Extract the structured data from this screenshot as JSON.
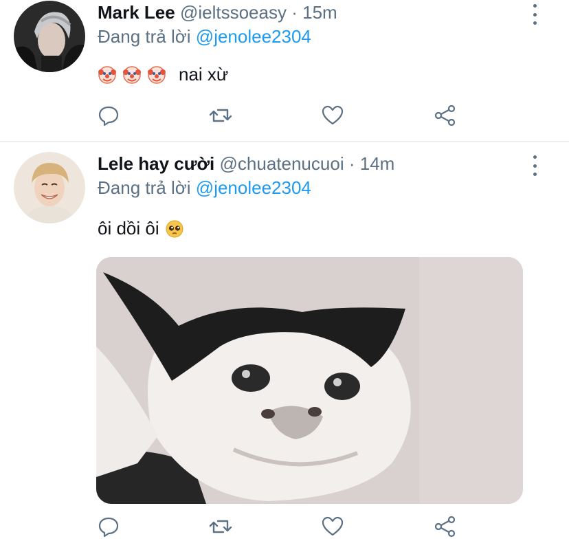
{
  "tweets": [
    {
      "name": "Mark Lee",
      "handle": "@ieltssoeasy",
      "separator": "·",
      "time": "15m",
      "reply_prefix": "Đang trả lời",
      "reply_to": "@jenolee2304",
      "emojis": [
        "clown-face-emoji",
        "clown-face-emoji",
        "clown-face-emoji"
      ],
      "text": "nai xừ"
    },
    {
      "name": "Lele hay cười",
      "handle": "@chuatenucuoi",
      "separator": "·",
      "time": "14m",
      "reply_prefix": "Đang trả lời",
      "reply_to": "@jenolee2304",
      "text": "ôi dồi ôi",
      "emoji_after": "pleading-face-emoji",
      "media": "crying-cat-photo"
    }
  ],
  "icons": {
    "reply": "reply-icon",
    "retweet": "retweet-icon",
    "like": "like-icon",
    "share": "share-icon",
    "more": "more-icon"
  },
  "colors": {
    "link": "#1d9bf0",
    "secondary_text": "#5b7083",
    "primary_text": "#0f1419",
    "divider": "#e3e6e8"
  }
}
